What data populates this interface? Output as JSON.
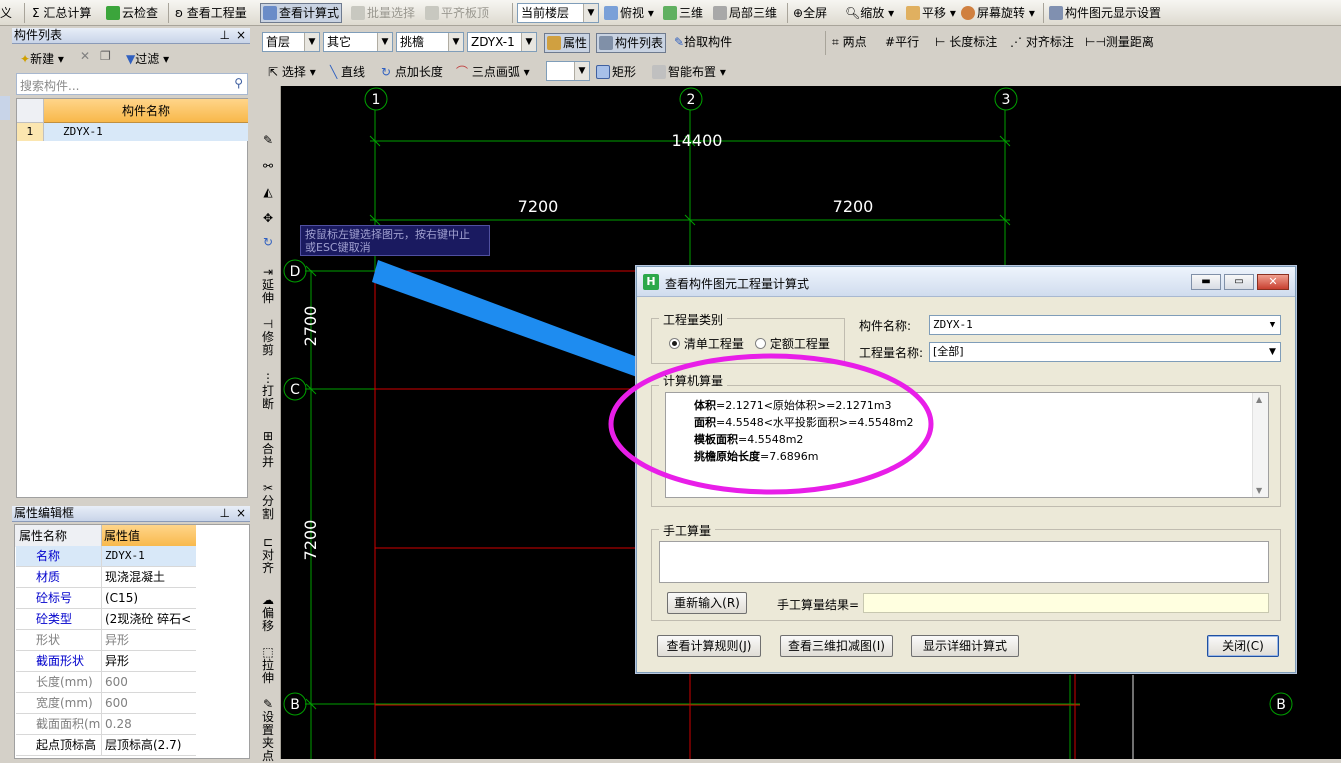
{
  "toolbar": {
    "define": "义",
    "summary": "汇总计算",
    "cloud_check": "云检查",
    "view_quantity": "查看工程量",
    "view_formula": "查看计算式",
    "batch_select": "批量选择",
    "flush_top": "平齐板顶",
    "floor_combo": "当前楼层",
    "top_view": "俯视",
    "three_d": "三维",
    "local_3d": "局部三维",
    "fullscreen": "全屏",
    "zoom": "缩放",
    "pan": "平移",
    "rotate": "屏幕旋转",
    "display_settings": "构件图元显示设置"
  },
  "toolbar2": {
    "floor": "首层",
    "category": "其它",
    "type": "挑檐",
    "component": "ZDYX-1",
    "props": "属性",
    "comp_list": "构件列表",
    "pick": "拾取构件",
    "two_point": "两点",
    "parallel": "平行",
    "length_mark": "长度标注",
    "align_mark": "对齐标注",
    "measure": "测量距离"
  },
  "toolbar3": {
    "select": "选择",
    "line": "直线",
    "point_length": "点加长度",
    "arc": "三点画弧",
    "rect": "矩形",
    "smart_layout": "智能布置"
  },
  "comp_panel": {
    "title": "构件列表",
    "new": "新建",
    "filter": "过滤",
    "search_placeholder": "搜索构件...",
    "col_name": "构件名称",
    "rows": [
      {
        "idx": "1",
        "name": "ZDYX-1"
      }
    ]
  },
  "prop_panel": {
    "title": "属性编辑框",
    "col_name": "属性名称",
    "col_value": "属性值",
    "rows": [
      {
        "k": "名称",
        "v": "ZDYX-1"
      },
      {
        "k": "材质",
        "v": "现浇混凝土"
      },
      {
        "k": "砼标号",
        "v": "(C15)"
      },
      {
        "k": "砼类型",
        "v": "(2现浇砼 碎石<"
      },
      {
        "k": "形状",
        "v": "异形"
      },
      {
        "k": "截面形状",
        "v": "异形"
      },
      {
        "k": "长度(mm)",
        "v": "600"
      },
      {
        "k": "宽度(mm)",
        "v": "600"
      },
      {
        "k": "截面面积(m",
        "v": "0.28"
      },
      {
        "k": "起点顶标高",
        "v": "层顶标高(2.7)"
      }
    ]
  },
  "vtools": {
    "extend": "延伸",
    "trim": "修剪",
    "break": "打断",
    "merge": "合并",
    "split": "分割",
    "align": "对齐",
    "offset": "偏移",
    "stretch": "拉伸",
    "set_point": "设置夹点"
  },
  "canvas": {
    "axis_1": "1",
    "axis_2": "2",
    "axis_3": "3",
    "axis_B": "B",
    "axis_C": "C",
    "axis_D": "D",
    "axis_B_right": "B",
    "dim_total": "14400",
    "dim_a": "7200",
    "dim_b": "7200",
    "dim_v1": "2700",
    "dim_v2": "7200",
    "hint_line1": "按鼠标左键选择图元，按右键中止",
    "hint_line2": "或ESC键取消"
  },
  "dialog": {
    "title": "查看构件图元工程量计算式",
    "qty_type_label": "工程量类别",
    "radio_list": "清单工程量",
    "radio_quota": "定额工程量",
    "comp_name_label": "构件名称:",
    "comp_name_value": "ZDYX-1",
    "qty_name_label": "工程量名称:",
    "qty_name_value": "[全部]",
    "computer_label": "计算机算量",
    "f1_key": "体积",
    "f1_val": "=2.1271<原始体积>=2.1271m3",
    "f2_key": "面积",
    "f2_val": "=4.5548<水平投影面积>=4.5548m2",
    "f3_key": "模板面积",
    "f3_val": "=4.5548m2",
    "f4_key": "挑檐原始长度",
    "f4_val": "=7.6896m",
    "manual_label": "手工算量",
    "reinput": "重新输入(R)",
    "manual_result_label": "手工算量结果=",
    "btn_rules": "查看计算规则(J)",
    "btn_3d": "查看三维扣减图(I)",
    "btn_detail": "显示详细计算式",
    "btn_close": "关闭(C)"
  },
  "colors": {
    "annotation_ellipse": "#e81ee8",
    "selected_member": "#1e90ff",
    "grid_line": "#00a000",
    "beam_line": "#d00000"
  }
}
